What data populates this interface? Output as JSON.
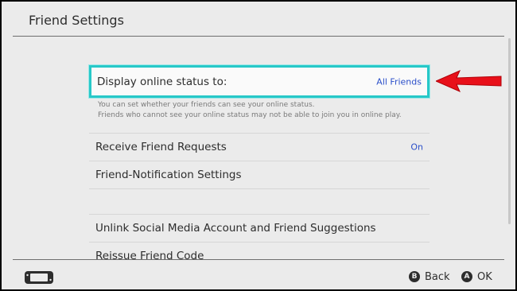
{
  "header": {
    "title": "Friend Settings"
  },
  "settings": {
    "online_status": {
      "label": "Display online status to:",
      "value": "All Friends",
      "desc_line1": "You can set whether your friends can see your online status.",
      "desc_line2": "Friends who cannot see your online status may not be able to join you in online play."
    },
    "friend_requests": {
      "label": "Receive Friend Requests",
      "value": "On"
    },
    "notifications": {
      "label": "Friend-Notification Settings"
    },
    "unlink": {
      "label": "Unlink Social Media Account and Friend Suggestions"
    },
    "reissue": {
      "label": "Reissue Friend Code"
    }
  },
  "footer": {
    "back_glyph": "B",
    "back_label": "Back",
    "ok_glyph": "A",
    "ok_label": "OK"
  },
  "icons": {
    "controller": "handheld-console-icon",
    "annotation": "red-arrow-icon"
  },
  "colors": {
    "selection_border": "#27c8c8",
    "value_text": "#2b4fc9",
    "annotation_arrow": "#e8101a"
  }
}
